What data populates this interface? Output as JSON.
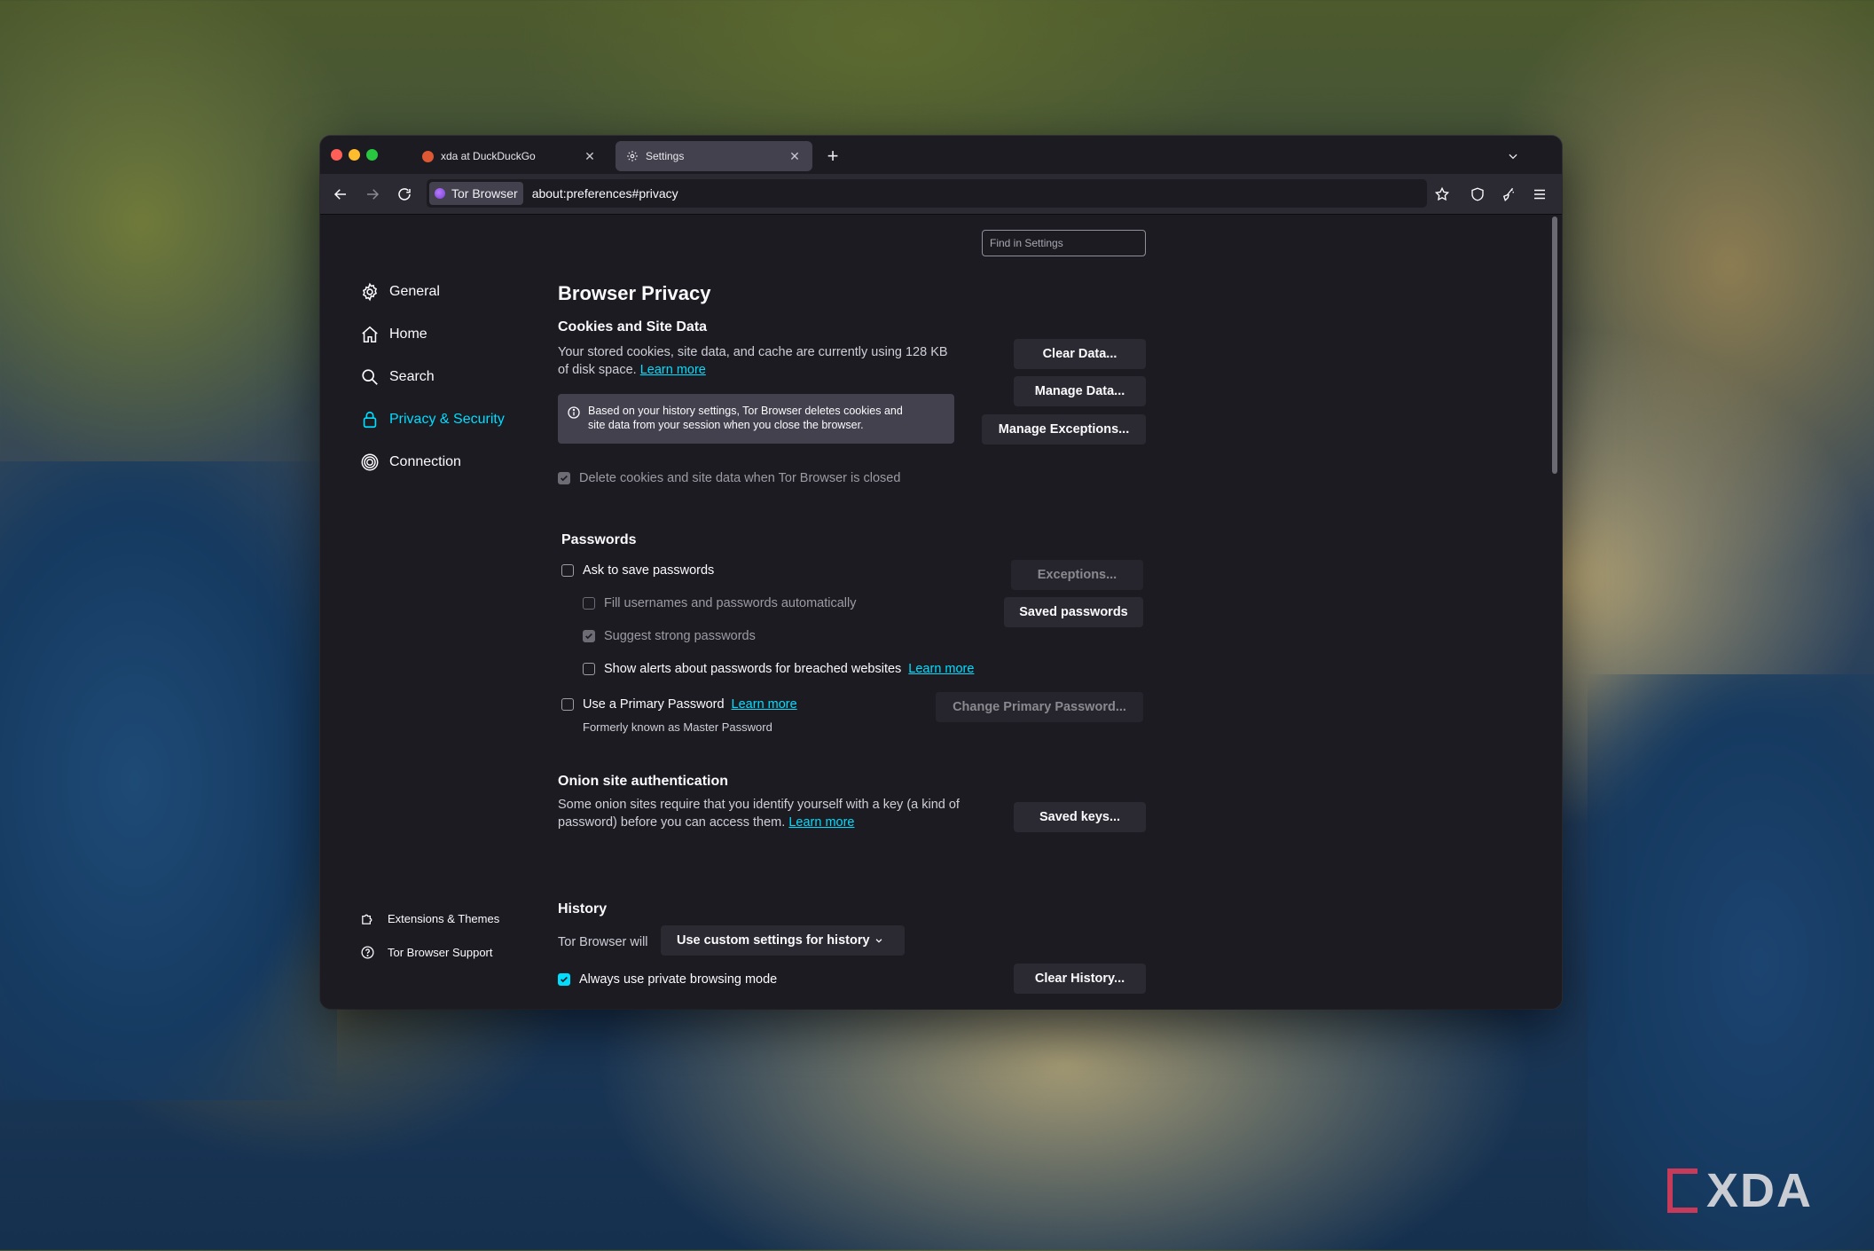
{
  "browser": {
    "tabs": [
      {
        "title": "xda at DuckDuckGo",
        "active": false,
        "favicon": "duckduckgo-icon"
      },
      {
        "title": "Settings",
        "active": true,
        "favicon": "gear-icon"
      }
    ],
    "identity_label": "Tor Browser",
    "url": "about:preferences#privacy"
  },
  "settings": {
    "find_placeholder": "Find in Settings",
    "sidebar": {
      "items": [
        {
          "label": "General",
          "icon": "gear-icon"
        },
        {
          "label": "Home",
          "icon": "home-icon"
        },
        {
          "label": "Search",
          "icon": "search-icon"
        },
        {
          "label": "Privacy & Security",
          "icon": "lock-icon",
          "selected": true
        },
        {
          "label": "Connection",
          "icon": "onion-icon"
        }
      ],
      "footer": [
        {
          "label": "Extensions & Themes",
          "icon": "puzzle-icon"
        },
        {
          "label": "Tor Browser Support",
          "icon": "help-icon"
        }
      ]
    },
    "title": "Browser Privacy",
    "cookies": {
      "heading": "Cookies and Site Data",
      "desc_line1": "Your stored cookies, site data, and cache are currently using 128 KB",
      "desc_line2": "of disk space.",
      "learn_more": "Learn more",
      "info_line1": "Based on your history settings, Tor Browser deletes cookies and",
      "info_line2": "site data from your session when you close the browser.",
      "delete_on_close": "Delete cookies and site data when Tor Browser is closed",
      "clear_data": "Clear Data...",
      "manage_data": "Manage Data...",
      "manage_exceptions": "Manage Exceptions..."
    },
    "passwords": {
      "heading": "Passwords",
      "ask_to_save": "Ask to save passwords",
      "autofill": "Fill usernames and passwords automatically",
      "suggest_strong": "Suggest strong passwords",
      "breach_alerts": "Show alerts about passwords for breached websites",
      "learn_more": "Learn more",
      "primary_password": "Use a Primary Password",
      "primary_learn_more": "Learn more",
      "formerly": "Formerly known as Master Password",
      "exceptions": "Exceptions...",
      "saved_passwords": "Saved passwords",
      "change_primary": "Change Primary Password..."
    },
    "onion": {
      "heading": "Onion site authentication",
      "desc_line1": "Some onion sites require that you identify yourself with a key (a kind of",
      "desc_line2": "password) before you can access them.",
      "learn_more": "Learn more",
      "saved_keys": "Saved keys..."
    },
    "history": {
      "heading": "History",
      "will_label": "Tor Browser will",
      "mode_selected": "Use custom settings for history",
      "private_mode": "Always use private browsing mode",
      "clear_history": "Clear History..."
    }
  },
  "colors": {
    "accent": "#00ddff",
    "background": "#1c1b22",
    "toolbar": "#2b2a33"
  },
  "watermark": "XDA"
}
